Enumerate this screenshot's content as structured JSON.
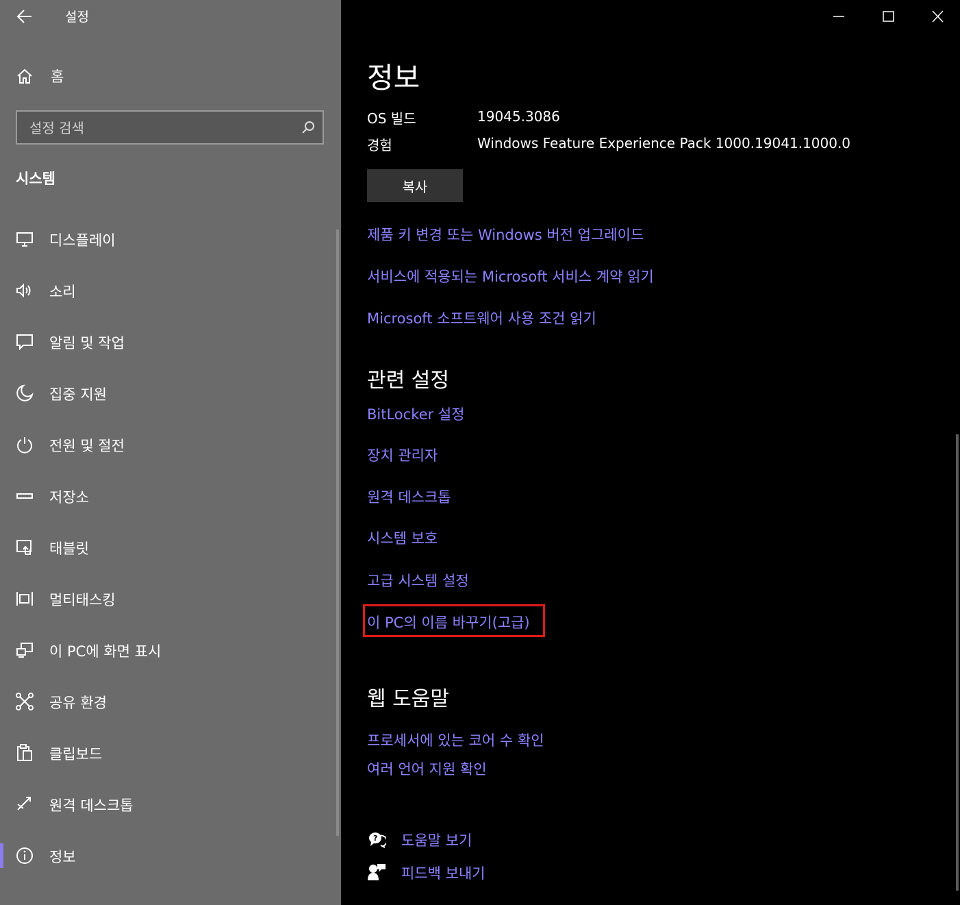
{
  "window": {
    "title": "설정"
  },
  "sidebar": {
    "home_label": "홈",
    "search_placeholder": "설정 검색",
    "section_title": "시스템",
    "items": [
      {
        "label": "디스플레이",
        "icon": "monitor-icon"
      },
      {
        "label": "소리",
        "icon": "speaker-icon"
      },
      {
        "label": "알림 및 작업",
        "icon": "notification-icon"
      },
      {
        "label": "집중 지원",
        "icon": "moon-icon"
      },
      {
        "label": "전원 및 절전",
        "icon": "power-icon"
      },
      {
        "label": "저장소",
        "icon": "storage-icon"
      },
      {
        "label": "태블릿",
        "icon": "tablet-icon"
      },
      {
        "label": "멀티태스킹",
        "icon": "multitask-icon"
      },
      {
        "label": "이 PC에 화면 표시",
        "icon": "project-icon"
      },
      {
        "label": "공유 환경",
        "icon": "share-icon"
      },
      {
        "label": "클립보드",
        "icon": "clipboard-icon"
      },
      {
        "label": "원격 데스크톱",
        "icon": "remote-icon"
      },
      {
        "label": "정보",
        "icon": "info-icon",
        "active": true
      }
    ]
  },
  "main": {
    "title": "정보",
    "specs": [
      {
        "key": "OS 빌드",
        "value": "19045.3086"
      },
      {
        "key": "경험",
        "value": "Windows Feature Experience Pack 1000.19041.1000.0"
      }
    ],
    "copy_label": "복사",
    "links": [
      "제품 키 변경 또는 Windows 버전 업그레이드",
      "서비스에 적용되는 Microsoft 서비스 계약 읽기",
      "Microsoft 소프트웨어 사용 조건 읽기"
    ],
    "related_title": "관련 설정",
    "related_links": [
      "BitLocker 설정",
      "장치 관리자",
      "원격 데스크톱",
      "시스템 보호",
      "고급 시스템 설정",
      "이 PC의 이름 바꾸기(고급)"
    ],
    "web_help_title": "웹 도움말",
    "web_links": [
      "프로세서에 있는 코어 수 확인",
      "여러 언어 지원 확인"
    ],
    "help_label": "도움말 보기",
    "feedback_label": "피드백 보내기"
  },
  "colors": {
    "link": "#8c82ff",
    "highlight": "#e01a1a",
    "accent": "#8c7cf0"
  }
}
